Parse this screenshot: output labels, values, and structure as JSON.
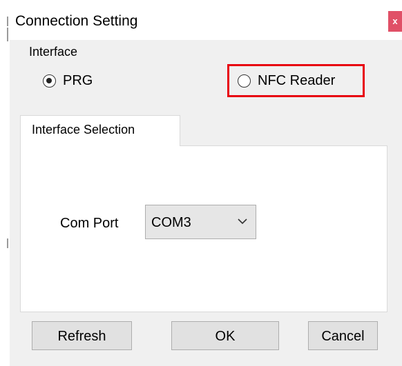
{
  "window": {
    "title": "Connection Setting",
    "close_glyph": "x"
  },
  "interface": {
    "label": "Interface",
    "options": [
      {
        "label": "PRG",
        "selected": true
      },
      {
        "label": "NFC Reader",
        "selected": false
      }
    ],
    "highlight_color": "#e8000f"
  },
  "tab": {
    "label": "Interface Selection"
  },
  "com_port": {
    "label": "Com Port",
    "value": "COM3"
  },
  "buttons": {
    "refresh": "Refresh",
    "ok": "OK",
    "cancel": "Cancel"
  }
}
